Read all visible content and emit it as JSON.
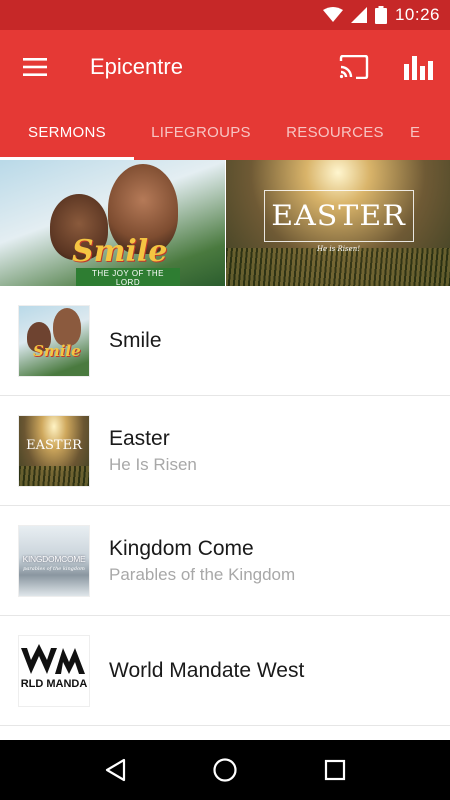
{
  "status": {
    "time": "10:26"
  },
  "appbar": {
    "title": "Epicentre"
  },
  "tabs": [
    {
      "label": "SERMONS",
      "active": true
    },
    {
      "label": "LIFEGROUPS",
      "active": false
    },
    {
      "label": "RESOURCES",
      "active": false
    },
    {
      "label": "E",
      "active": false
    }
  ],
  "carousel": {
    "slides": [
      {
        "art_text": "Smile",
        "art_banner": "THE JOY OF THE LORD"
      },
      {
        "art_text": "EASTER",
        "art_sub": "He is Risen!"
      }
    ]
  },
  "sermons": [
    {
      "title": "Smile",
      "subtitle": "",
      "thumb_text": "Smile"
    },
    {
      "title": "Easter",
      "subtitle": "He Is Risen",
      "thumb_text": "EASTER"
    },
    {
      "title": "Kingdom Come",
      "subtitle": "Parables of the Kingdom",
      "thumb_text": "KINGDOMCOME",
      "thumb_sub": "parables of the kingdom"
    },
    {
      "title": "World Mandate West",
      "subtitle": "",
      "thumb_text": "RLD MANDA"
    }
  ],
  "colors": {
    "primary": "#e53935",
    "status_bar": "#c62828",
    "nav_bar": "#000000"
  },
  "icons": {
    "menu": "hamburger-icon",
    "cast": "cast-icon",
    "stats": "bar-chart-icon",
    "wifi": "wifi-icon",
    "signal": "signal-icon",
    "battery": "battery-icon",
    "back": "back-icon",
    "home": "home-icon",
    "recents": "recents-icon"
  }
}
